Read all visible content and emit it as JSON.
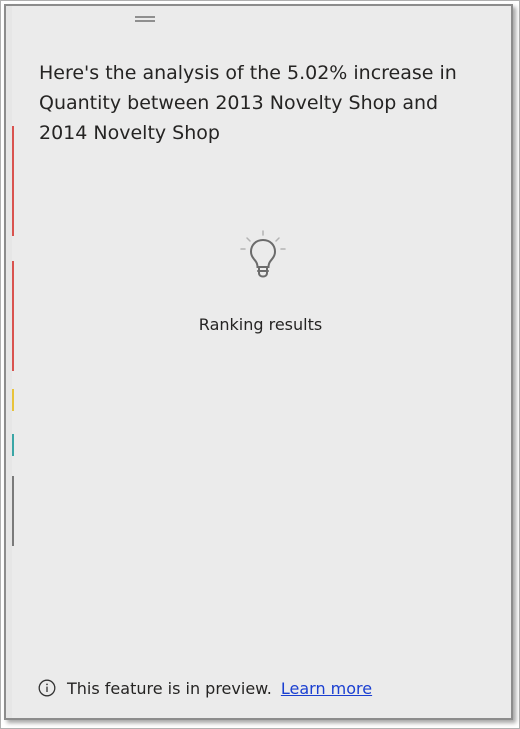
{
  "insight": {
    "headline": "Here's the analysis of the 5.02% increase in Quantity between 2013 Novelty Shop and 2014 Novelty Shop",
    "status": "Ranking results",
    "status_icon": "lightbulb-icon"
  },
  "footer": {
    "info_icon": "info-icon",
    "preview_text": "This feature is in preview.",
    "link_label": "Learn more"
  },
  "colors": {
    "panel_background": "#ebebeb",
    "text": "#252423",
    "link": "#1a3fd1",
    "icon": "#6b6b6b"
  }
}
